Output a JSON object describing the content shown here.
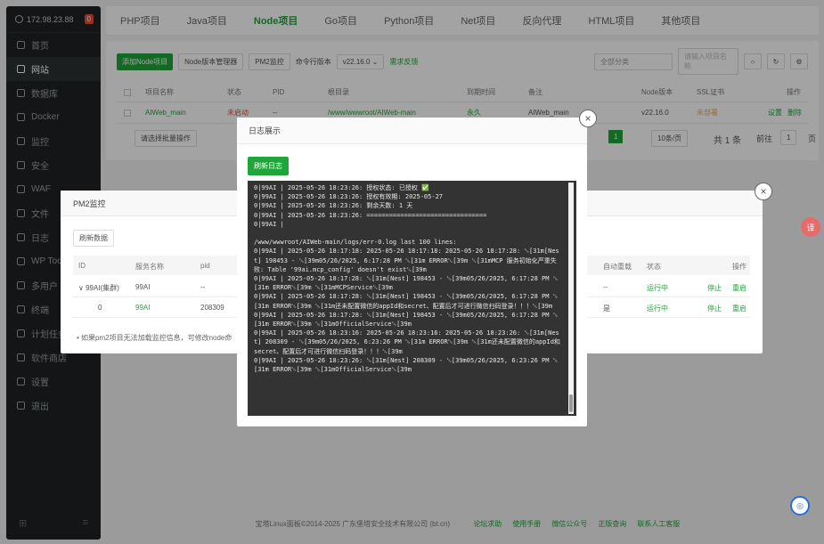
{
  "server": {
    "ip": "172.98.23.88",
    "badge": "0"
  },
  "sidebar": {
    "items": [
      {
        "label": "首页"
      },
      {
        "label": "网站",
        "active": true
      },
      {
        "label": "数据库"
      },
      {
        "label": "Docker"
      },
      {
        "label": "监控"
      },
      {
        "label": "安全"
      },
      {
        "label": "WAF"
      },
      {
        "label": "文件"
      },
      {
        "label": "日志"
      },
      {
        "label": "WP Tool"
      },
      {
        "label": "多用户"
      },
      {
        "label": "终端"
      },
      {
        "label": "计划任务"
      },
      {
        "label": "软件商店"
      },
      {
        "label": "设置"
      },
      {
        "label": "退出"
      }
    ],
    "footer_left": "⊞",
    "footer_right": "≡"
  },
  "topbar": {
    "tabs": [
      {
        "label": "PHP项目"
      },
      {
        "label": "Java项目"
      },
      {
        "label": "Node项目",
        "active": true
      },
      {
        "label": "Go项目"
      },
      {
        "label": "Python项目"
      },
      {
        "label": "Net项目"
      },
      {
        "label": "反向代理"
      },
      {
        "label": "HTML项目"
      },
      {
        "label": "其他项目"
      }
    ]
  },
  "main": {
    "add_btn": "添加Node项目",
    "version_mgr": "Node版本管理器",
    "pm2_btn": "PM2监控",
    "cli_label": "命令行版本",
    "cli_version": "v22.16.0",
    "feedback": "需求反馈",
    "category": "全部分类",
    "search_placeholder": "请输入项目名称",
    "columns": [
      "项目名称",
      "状态",
      "PID",
      "根目录",
      "到期时间",
      "备注",
      "Node版本",
      "SSL证书",
      "操作"
    ],
    "row": {
      "name": "AIWeb_main",
      "status": "未启动",
      "pid": "--",
      "root": "/www/wwwroot/AIWeb-main",
      "expire": "永久",
      "note": "AIWeb_main",
      "node_version": "v22.16.0",
      "ssl": "未部署",
      "op1": "设置",
      "op2": "删除"
    },
    "batch": "请选择批量操作",
    "page": "1",
    "per_page": "10条/页",
    "total": "共 1 条",
    "goto": "前往",
    "goto_page": "1",
    "page_unit": "页"
  },
  "pm2": {
    "title": "PM2监控",
    "refresh": "刷新数据",
    "columns": [
      "ID",
      "服务名称",
      "pid",
      "自动重载",
      "状态",
      "操作"
    ],
    "rows": [
      {
        "id": "∨ 99AI(集群)",
        "name": "99AI",
        "pid": "--",
        "reload": "--",
        "status": "运行中",
        "stop": "停止",
        "restart": "重启"
      },
      {
        "id": "0",
        "name": "99AI",
        "pid": "208309",
        "reload": "是",
        "status": "运行中",
        "stop": "停止",
        "restart": "重启"
      }
    ],
    "note": "• 如果pm2项目无法加载监控信息，可修改node命"
  },
  "log": {
    "title": "日志展示",
    "refresh": "刷新日志",
    "content": "0|99AI | 2025-05-26 18:23:26: 授权状态: 已授权 ✅\n0|99AI | 2025-05-26 18:23:26: 授权有效期: 2025-05-27\n0|99AI | 2025-05-26 18:23:26: 剩余天数: 1 天\n0|99AI | 2025-05-26 18:23:26: ================================\n0|99AI |\n\n/www/wwwroot/AIWeb-main/logs/err-0.log last 100 lines:\n0|99AI | 2025-05-26 18:17:18: 2025-05-26 18:17:18: 2025-05-26 18:17:28: ␛[31m[Nest] 198453 - ␛[39m05/26/2025, 6:17:28 PM ␛[31m ERROR␛[39m ␛[31mMCP 服务初始化严重失败: Table '99ai.mcp_config' doesn't exist␛[39m\n0|99AI | 2025-05-26 18:17:28: ␛[31m[Nest] 198453 - ␛[39m05/26/2025, 6:17:28 PM ␛[31m ERROR␛[39m ␛[31mMCPService␛[39m\n0|99AI | 2025-05-26 18:17:28: ␛[31m[Nest] 198453 - ␛[39m05/26/2025, 6:17:28 PM ␛[31m ERROR␛[39m ␛[31m还未配置微信的appId和secret、配置后才可进行微信扫码登录！！！␛[39m\n0|99AI | 2025-05-26 18:17:28: ␛[31m[Nest] 198453 - ␛[39m05/26/2025, 6:17:28 PM ␛[31m ERROR␛[39m ␛[31mOfficialService␛[39m\n0|99AI | 2025-05-26 18:23:16: 2025-05-26 18:23:16: 2025-05-26 18:23:26: ␛[31m[Nest] 208309 - ␛[39m05/26/2025, 6:23:26 PM ␛[31m ERROR␛[39m ␛[31m还未配置微信的appId和secret、配置后才可进行微信扫码登录！！！␛[39m\n0|99AI | 2025-05-26 18:23:26: ␛[31m[Nest] 208309 - ␛[39m05/26/2025, 6:23:26 PM ␛[31m ERROR␛[39m ␛[31mOfficialService␛[39m"
  },
  "footer": {
    "copyright": "宝塔Linux面板©2014-2025 广东堡塔安全技术有限公司 (bt.cn)",
    "links": [
      "论坛求助",
      "使用手册",
      "微信公众号",
      "正版查询",
      "联系人工客服"
    ]
  },
  "colors": {
    "accent": "#20a53a",
    "danger": "#e64d30",
    "sidebar": "#1e2224"
  }
}
